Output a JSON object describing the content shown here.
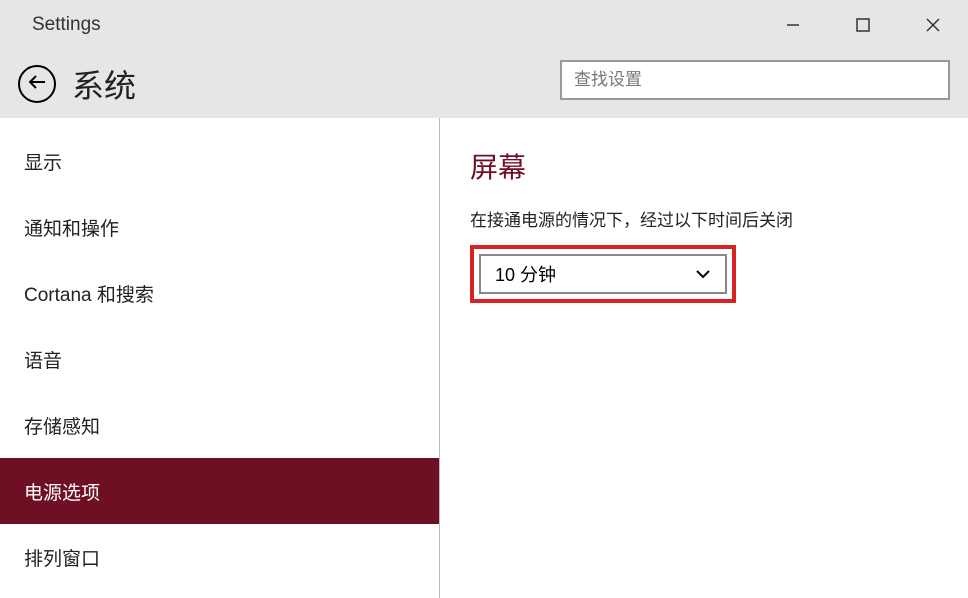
{
  "window": {
    "title": "Settings"
  },
  "header": {
    "title": "系统",
    "search_placeholder": "查找设置"
  },
  "sidebar": {
    "items": [
      {
        "label": "显示",
        "selected": false
      },
      {
        "label": "通知和操作",
        "selected": false
      },
      {
        "label": "Cortana 和搜索",
        "selected": false
      },
      {
        "label": "语音",
        "selected": false
      },
      {
        "label": "存储感知",
        "selected": false
      },
      {
        "label": "电源选项",
        "selected": true
      },
      {
        "label": "排列窗口",
        "selected": false
      }
    ]
  },
  "content": {
    "section_title": "屏幕",
    "field_label": "在接通电源的情况下，经过以下时间后关闭",
    "dropdown_value": "10 分钟"
  },
  "colors": {
    "accent": "#6f0f23",
    "highlight": "#d62323",
    "titlebar_bg": "#e6e6e6"
  }
}
